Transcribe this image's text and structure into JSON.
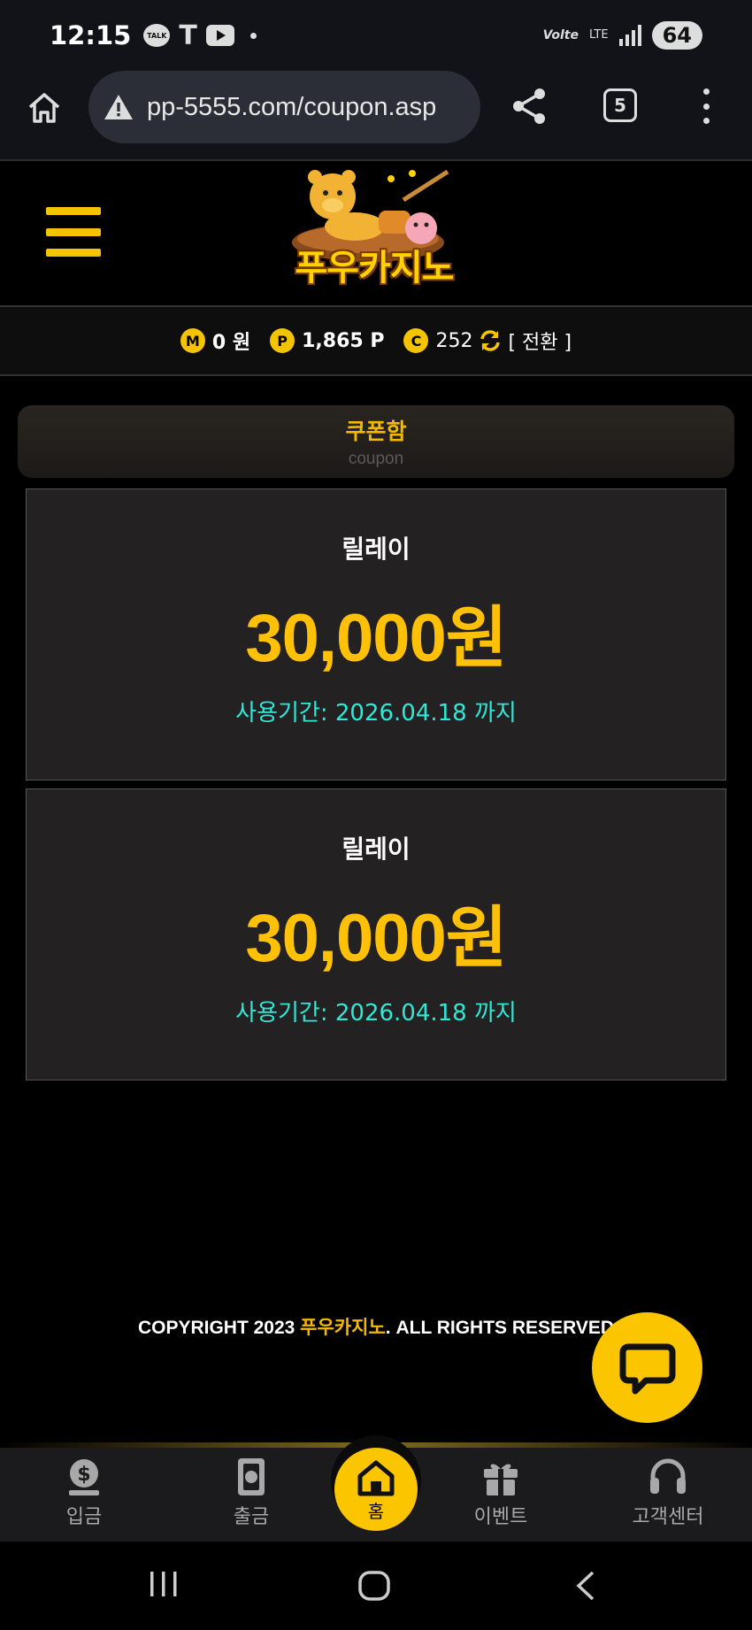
{
  "status_bar": {
    "time": "12:15",
    "talk_label": "TALK",
    "t_label": "T",
    "volte_label": "Volte",
    "lte_label": "LTE",
    "battery": "64"
  },
  "browser": {
    "url": "pp-5555.com/coupon.asp",
    "tab_count": "5"
  },
  "site": {
    "logo_text": "푸우카지노"
  },
  "balance": {
    "money_icon_letter": "M",
    "money": "0 원",
    "point_icon_letter": "P",
    "points": "1,865 P",
    "coin_icon_letter": "C",
    "coins": "252",
    "convert_label": "[ 전환 ]"
  },
  "coupon_box": {
    "title": "쿠폰함",
    "subtitle": "coupon"
  },
  "coupons": [
    {
      "name": "릴레이",
      "amount": "30,000원",
      "expiry": "사용기간: 2026.04.18 까지"
    },
    {
      "name": "릴레이",
      "amount": "30,000원",
      "expiry": "사용기간: 2026.04.18 까지"
    }
  ],
  "footer": {
    "copyright_prefix": "COPYRIGHT 2023 ",
    "brand": "푸우카지노",
    "copyright_suffix": ". ALL RIGHTS RESERVED"
  },
  "bottom_nav": {
    "deposit": "입금",
    "withdraw": "출금",
    "home": "홈",
    "event": "이벤트",
    "support": "고객센터"
  },
  "colors": {
    "accent": "#ffc107",
    "expiry": "#2fe8d8",
    "background": "#000000"
  }
}
